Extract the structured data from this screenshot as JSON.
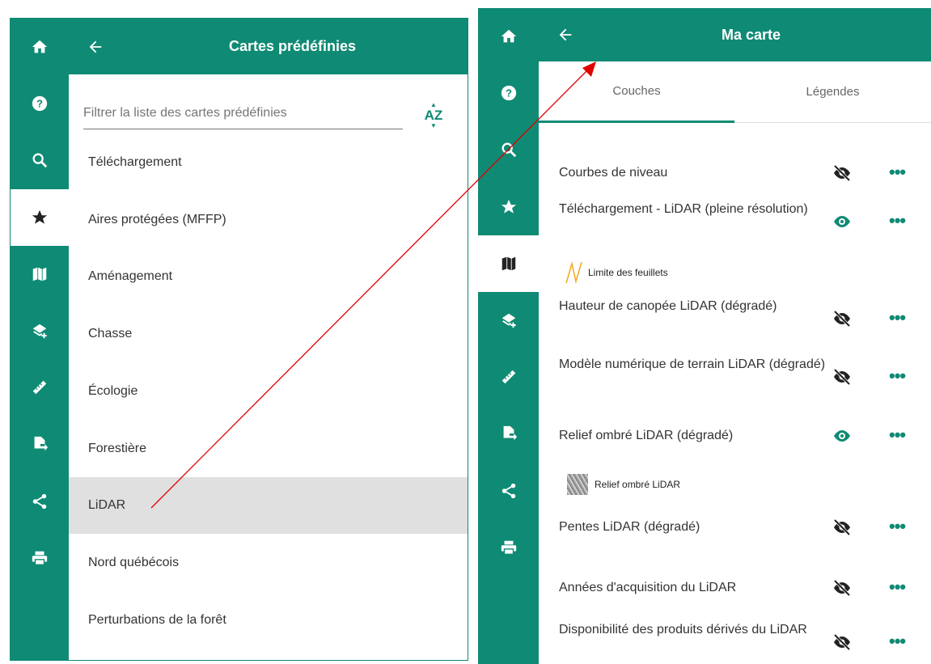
{
  "colors": {
    "primary": "#0f8a74",
    "selected_bg": "#e0e0e0"
  },
  "rail_icons": [
    "home-icon",
    "help-icon",
    "search-icon",
    "star-icon",
    "map-icon",
    "add-layer-icon",
    "ruler-icon",
    "export-file-icon",
    "share-icon",
    "print-icon"
  ],
  "left_panel": {
    "title": "Cartes prédéfinies",
    "filter_placeholder": "Filtrer la liste des cartes prédéfinies",
    "sort_label": "AZ",
    "items": [
      "Téléchargement",
      "Aires protégées (MFFP)",
      "Aménagement",
      "Chasse",
      "Écologie",
      "Forestière",
      "LiDAR",
      "Nord québécois",
      "Perturbations de la forêt"
    ],
    "selected_index": 6
  },
  "right_panel": {
    "title": "Ma carte",
    "tabs": [
      "Couches",
      "Légendes"
    ],
    "active_tab": 0,
    "layers": [
      {
        "name": "Courbes de niveau",
        "visible": false
      },
      {
        "name": "Téléchargement - LiDAR (pleine résolution)",
        "visible": true
      },
      {
        "name": "Hauteur de canopée LiDAR (dégradé)",
        "visible": false
      },
      {
        "name": "Modèle numérique de terrain LiDAR (dégradé)",
        "visible": false
      },
      {
        "name": "Relief ombré LiDAR (dégradé)",
        "visible": true
      },
      {
        "name": "Pentes LiDAR (dégradé)",
        "visible": false
      },
      {
        "name": "Années d'acquisition du LiDAR",
        "visible": false
      },
      {
        "name": "Disponibilité des produits dérivés du LiDAR",
        "visible": false
      }
    ],
    "legends": [
      "Limite des feuillets",
      "Relief ombré LiDAR"
    ],
    "more_label": "•••"
  }
}
